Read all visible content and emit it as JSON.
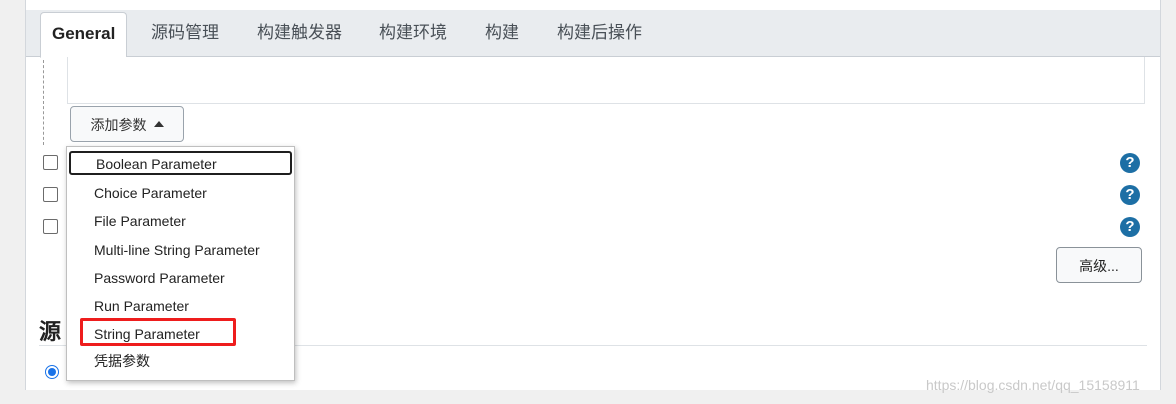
{
  "tabs": [
    {
      "label": "General",
      "active": true
    },
    {
      "label": "源码管理"
    },
    {
      "label": "构建触发器"
    },
    {
      "label": "构建环境"
    },
    {
      "label": "构建"
    },
    {
      "label": "构建后操作"
    }
  ],
  "add_param_button": {
    "label": "添加参数",
    "icon": "caret-up-icon"
  },
  "menu": {
    "items": [
      "Boolean Parameter",
      "Choice Parameter",
      "File Parameter",
      "Multi-line String Parameter",
      "Password Parameter",
      "Run Parameter",
      "String Parameter",
      "凭据参数"
    ],
    "focused_index": 0,
    "highlighted_index": 6,
    "highlight_color": "#ee1d1d"
  },
  "help_icon": {
    "glyph": "?",
    "color": "#1d6fa5"
  },
  "advanced_button": {
    "label": "高级..."
  },
  "section": {
    "title_partial": "源"
  },
  "watermark": "https://blog.csdn.net/qq_15158911"
}
